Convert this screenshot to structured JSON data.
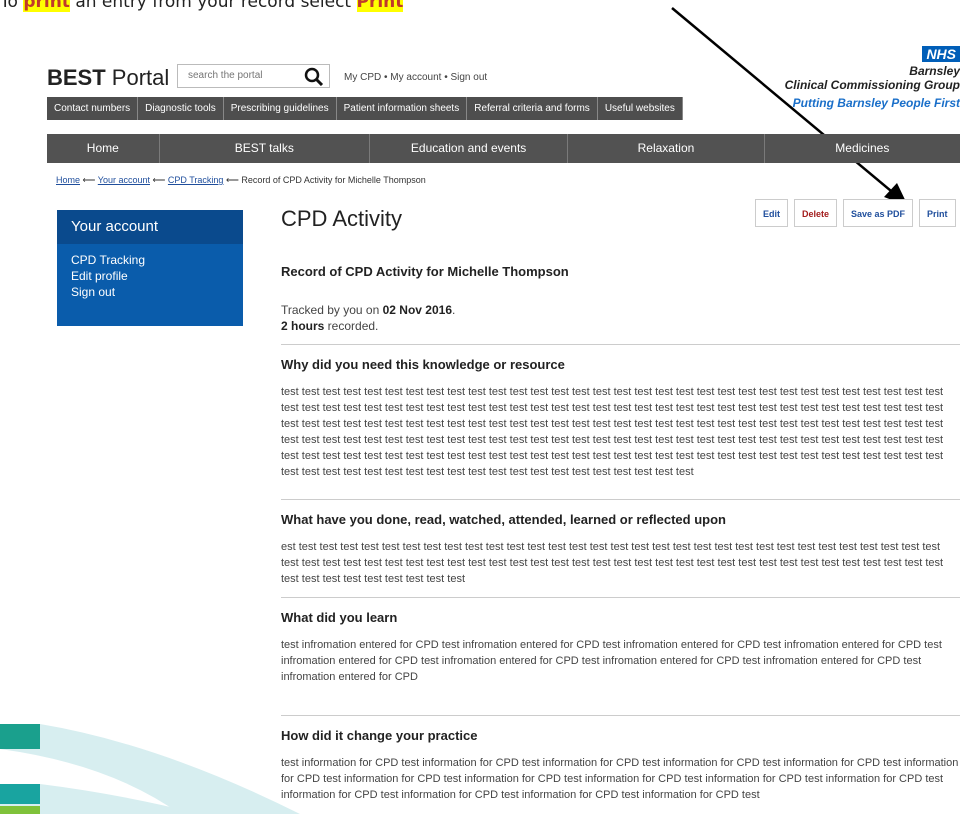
{
  "instruction": {
    "prefix": "To ",
    "print_word": "print",
    "middle": " an entry from your record select ",
    "select_word": "Print"
  },
  "header": {
    "logo_bold": "BEST",
    "logo_rest": " Portal",
    "search_placeholder": "search the portal",
    "links": "My CPD • My account • Sign out"
  },
  "nhs": {
    "badge": "NHS",
    "area": "Barnsley",
    "ccg": "Clinical Commissioning Group",
    "tagline": "Putting Barnsley People First"
  },
  "tabs": [
    "Contact numbers",
    "Diagnostic tools",
    "Prescribing guidelines",
    "Patient information sheets",
    "Referral criteria and forms",
    "Useful websites"
  ],
  "mainnav": [
    "Home",
    "BEST talks",
    "Education and events",
    "Relaxation",
    "Medicines"
  ],
  "breadcrumb": {
    "home": "Home",
    "account": "Your account",
    "tracking": "CPD Tracking",
    "current": "Record of CPD Activity for Michelle Thompson"
  },
  "sidebar": {
    "title": "Your account",
    "items": [
      "CPD Tracking",
      "Edit profile",
      "Sign out"
    ]
  },
  "content": {
    "title": "CPD Activity",
    "buttons": {
      "edit": "Edit",
      "delete": "Delete",
      "save_pdf": "Save as PDF",
      "print": "Print"
    },
    "record_title": "Record of CPD Activity for Michelle Thompson",
    "tracked_prefix": "Tracked by you on ",
    "tracked_date": "02 Nov 2016",
    "tracked_suffix": ".",
    "hours_bold": "2 hours",
    "hours_suffix": " recorded.",
    "sections": [
      {
        "heading": "Why did you need this knowledge or resource",
        "body": "test test test test test test test test test test test test test test test test test test test test test test test test test test test test test test test test test test test test test test test test test test test test test test test test test test test test test test test test test test test test test test test test test test test test test test test test test test test test test test test test test test test test test test test test test test test test test test test test test test test test test test test test test test test test test test test test test test test test test test test test test test test test test test test test test test test test test test test test test test test test test test test test test test test test test test test test test test test test test test test test test test test test test test test test test test test test test test test test test test test test"
      },
      {
        "heading": "What have you done, read, watched, attended, learned or reflected upon",
        "body": "est test test test test test test test test test test test test test test test test test test test test test test test test test test test test test test test test test test test test test test test test test test test test test test test test test test test test test test test test test test test test test test test test test test test test test test test test"
      },
      {
        "heading": "What did you learn",
        "body": "test infromation entered for CPD test infromation entered for CPD test infromation entered for CPD test infromation entered for CPD test infromation entered for CPD test infromation entered for CPD test infromation entered for CPD test infromation entered for CPD test infromation entered for CPD"
      },
      {
        "heading": "How did it change your practice",
        "body": " test information for CPD test information for CPD test information for CPD test information for CPD test information for CPD test information for CPD test information for CPD test information for CPD test information for CPD test information for CPD test information for CPD test information for CPD test information for CPD test information for CPD test information for CPD test"
      }
    ]
  }
}
